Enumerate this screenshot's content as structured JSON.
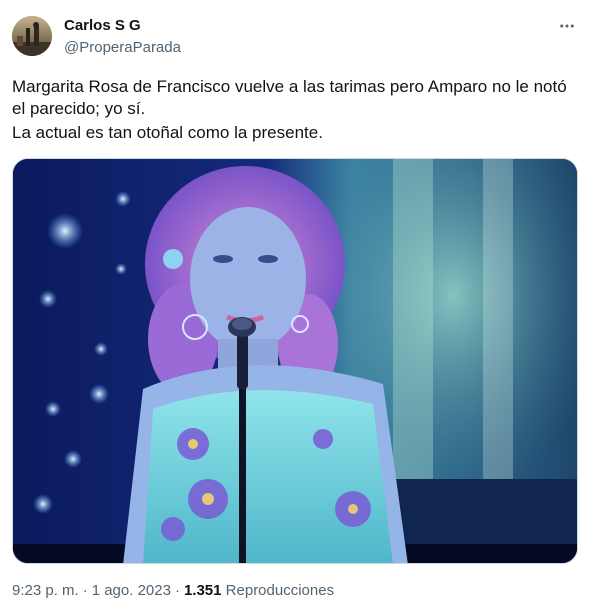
{
  "author": {
    "display_name": "Carlos S G",
    "handle": "@ProperaParada"
  },
  "tweet": {
    "text_lines": [
      "Margarita Rosa de Francisco vuelve a las tarimas pero Amparo no le notó",
      "el parecido; yo sí.",
      "La actual es tan otoñal como la presente."
    ]
  },
  "meta": {
    "time": "9:23 p. m.",
    "separator": "·",
    "date": "1 ago. 2023",
    "views_count": "1.351",
    "views_label": "Reproducciones"
  },
  "icons": {
    "more": "more-horizontal-icon",
    "avatar": "avatar-photo"
  },
  "colors": {
    "text_primary": "#0f1419",
    "text_secondary": "#536471",
    "border": "#cfd9de"
  }
}
